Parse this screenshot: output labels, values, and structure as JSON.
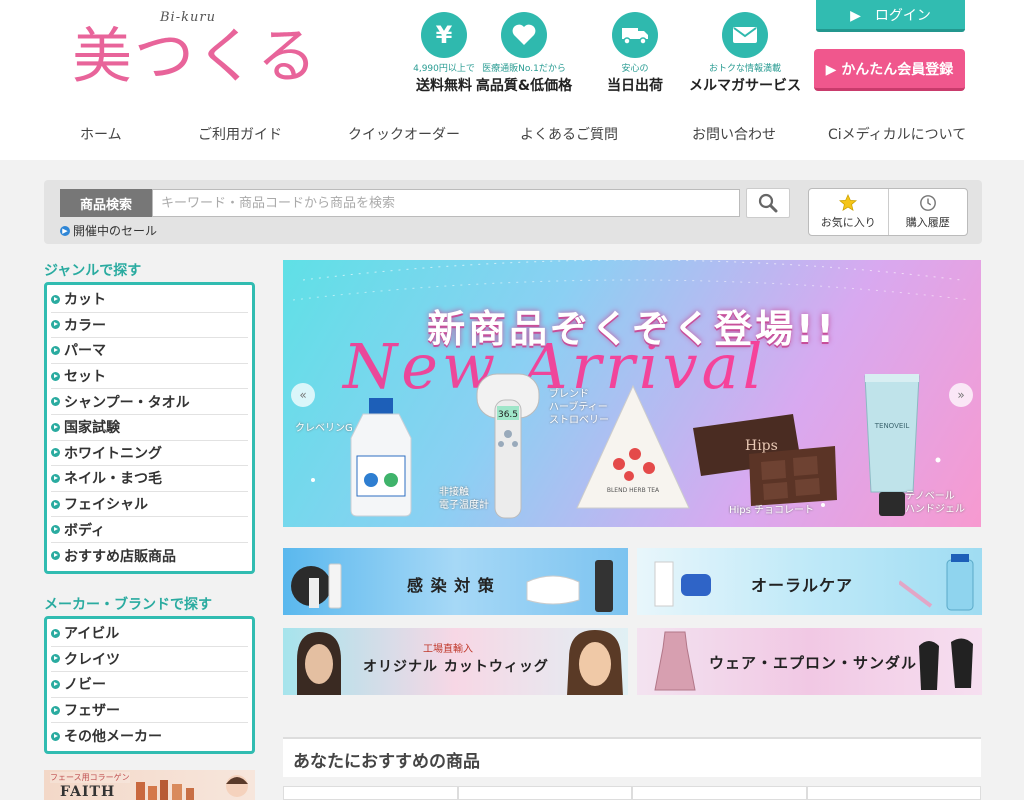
{
  "header": {
    "logo_main": "美つくる",
    "logo_sub": "Bi-kuru",
    "features": [
      {
        "icon": "yen-icon",
        "sub": "4,990円以上で",
        "main": "送料無料"
      },
      {
        "icon": "heart-icon",
        "sub": "医療通販No.1だから",
        "main": "高品質&低価格"
      },
      {
        "icon": "truck-icon",
        "sub": "安心の",
        "main": "当日出荷"
      },
      {
        "icon": "mail-icon",
        "sub": "おトクな情報満載",
        "main": "メルマガサービス"
      }
    ],
    "login_label": "▶　ログイン",
    "register_label": "▶ かんたん会員登録"
  },
  "nav": {
    "items": [
      "ホーム",
      "ご利用ガイド",
      "クイックオーダー",
      "よくあるご質問",
      "お問い合わせ",
      "Ciメディカルについて"
    ]
  },
  "search": {
    "label": "商品検索",
    "placeholder": "キーワード・商品コードから商品を検索",
    "sale_link": "開催中のセール",
    "favorites_label": "お気に入り",
    "history_label": "購入履歴"
  },
  "sidebar": {
    "genre_heading": "ジャンルで探す",
    "genres": [
      "カット",
      "カラー",
      "パーマ",
      "セット",
      "シャンプー・タオル",
      "国家試験",
      "ホワイトニング",
      "ネイル・まつ毛",
      "フェイシャル",
      "ボディ",
      "おすすめ店販商品"
    ],
    "maker_heading": "メーカー・ブランドで探す",
    "makers": [
      "アイビル",
      "クレイツ",
      "ノビー",
      "フェザー",
      "その他メーカー"
    ],
    "banner_tag": "フェース用コラーゲン",
    "banner_brand": "FAITH"
  },
  "hero": {
    "title": "新商品ぞくぞく登場!!",
    "script": "New Arrival",
    "labels": {
      "p1": "クレベリンG",
      "p2": "非接触\n電子温度計",
      "p3": "ブレンド\nハーブティー\nストロベリー",
      "p3_box": "BLEND HERB TEA",
      "p4": "Hips チョコレート",
      "p4_box": "Hips",
      "p5": "テノベール\nハンドジェル",
      "p5_box": "TENOVEIL"
    },
    "thermo_reading": "36.5"
  },
  "categories": {
    "infection": "感 染 対 策",
    "oral": "オーラルケア",
    "wig_sub": "工場直輸入",
    "wig": "オリジナル カットウィッグ",
    "wear": "ウェア・エプロン・サンダル"
  },
  "recommended": {
    "title": "あなたにおすすめの商品"
  }
}
